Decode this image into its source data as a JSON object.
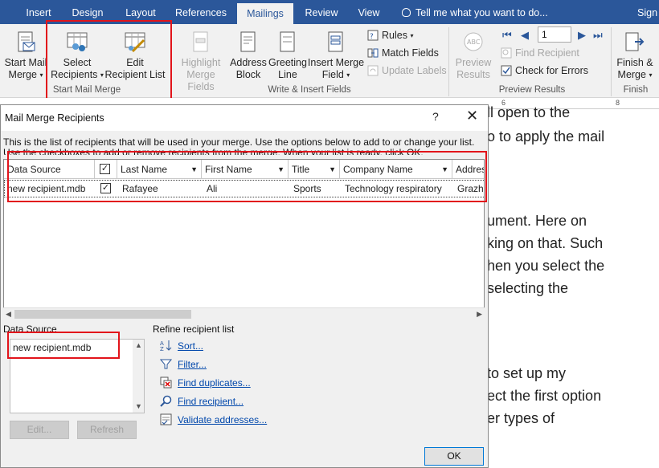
{
  "tabs": [
    {
      "label": "Insert"
    },
    {
      "label": "Design"
    },
    {
      "label": "Layout"
    },
    {
      "label": "References"
    },
    {
      "label": "Mailings"
    },
    {
      "label": "Review"
    },
    {
      "label": "View"
    }
  ],
  "tell_me": "Tell me what you want to do...",
  "sign_in": "Sign",
  "ribbon": {
    "start_mail_merge": {
      "line1": "Start Mail",
      "line2": "Merge"
    },
    "select_recipients": {
      "line1": "Select",
      "line2": "Recipients"
    },
    "edit_recipient_list": {
      "line1": "Edit",
      "line2": "Recipient List"
    },
    "group_start": "Start Mail Merge",
    "highlight": {
      "line1": "Highlight",
      "line2": "Merge Fields"
    },
    "address_block": {
      "line1": "Address",
      "line2": "Block"
    },
    "greeting_line": {
      "line1": "Greeting",
      "line2": "Line"
    },
    "insert_merge_field": {
      "line1": "Insert Merge",
      "line2": "Field"
    },
    "rules": "Rules",
    "match_fields": "Match Fields",
    "update_labels": "Update Labels",
    "group_write": "Write & Insert Fields",
    "preview_results": {
      "line1": "Preview",
      "line2": "Results"
    },
    "record_number": "1",
    "find_recipient": "Find Recipient",
    "check_for_errors": "Check for Errors",
    "group_preview": "Preview Results",
    "finish_merge": {
      "line1": "Finish &",
      "line2": "Merge"
    },
    "group_finish": "Finish"
  },
  "document_lines": [
    "ll open to the",
    "o to apply the mail",
    "ument. Here on",
    "king on that. Such",
    "hen you select the",
    "selecting the",
    "to set up my",
    "ect the first option",
    "er types of"
  ],
  "dialog": {
    "title": "Mail Merge Recipients",
    "help": "?",
    "instruction1": "This is the list of recipients that will be used in your merge.  Use the options below to add to or change your list.",
    "instruction2": "Use the checkboxes to add or remove recipients from the merge.  When your list is ready, click OK.",
    "columns": [
      "Data Source",
      "",
      "Last Name",
      "First Name",
      "Title",
      "Company Name",
      "Address"
    ],
    "rows": [
      {
        "data_source": "new recipient.mdb",
        "checked": "✓",
        "last_name": "Rafayee",
        "first_name": "Ali",
        "title": "Sports",
        "company": "Technology respiratory",
        "address": "Grazho"
      }
    ],
    "data_source_label": "Data Source",
    "data_source_item": "new recipient.mdb",
    "refine_label": "Refine recipient list",
    "links": [
      "Sort...",
      "Filter...",
      "Find duplicates...",
      "Find recipient...",
      "Validate addresses..."
    ],
    "edit_button": "Edit...",
    "refresh_button": "Refresh",
    "ok_button": "OK"
  }
}
